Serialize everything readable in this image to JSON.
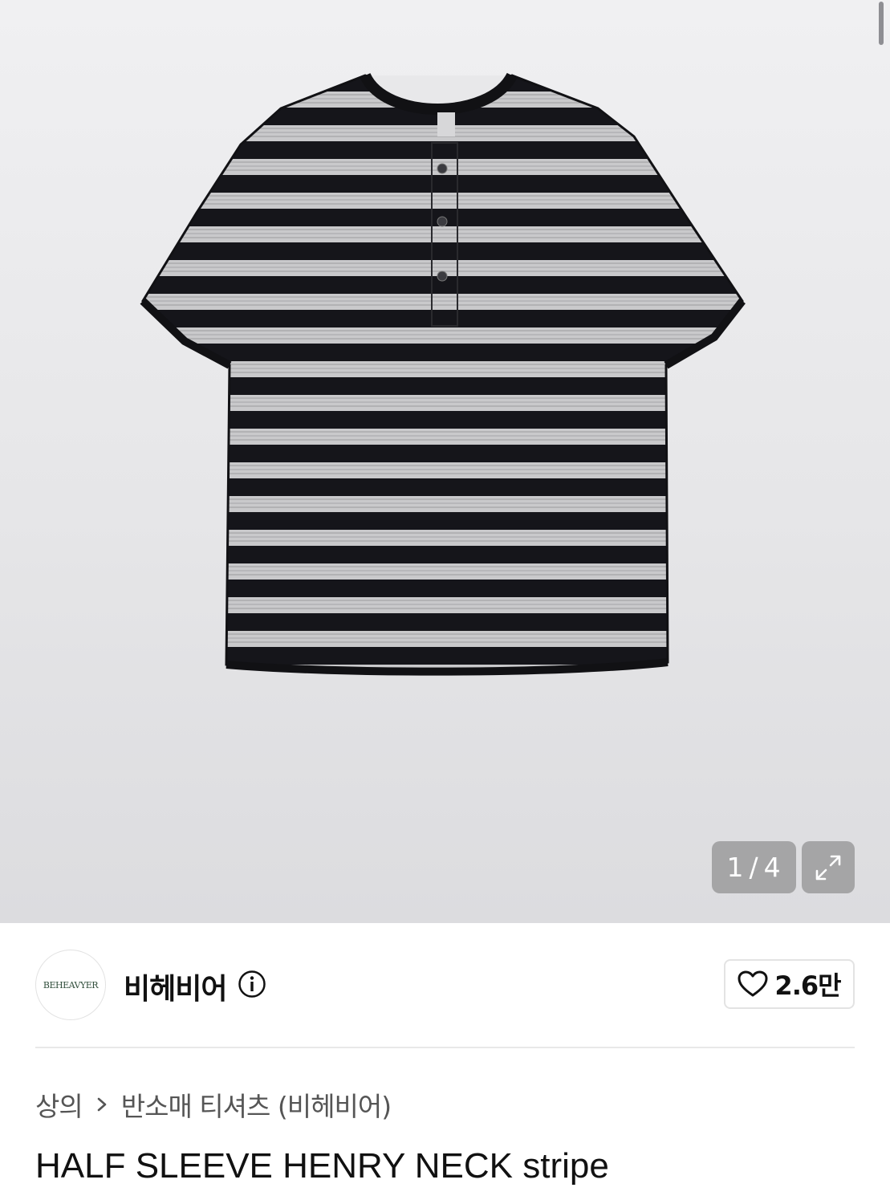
{
  "gallery": {
    "current_index": "1",
    "separator": "/",
    "total": "4",
    "image_alt": "HALF SLEEVE HENRY NECK stripe"
  },
  "brand": {
    "name": "비헤비어",
    "logo_text": "BEHEAVYER"
  },
  "likes": {
    "count": "2.6만"
  },
  "breadcrumb": {
    "category": "상의",
    "subcategory": "반소매 티셔츠 (비헤비어)"
  },
  "product": {
    "title": "HALF SLEEVE HENRY NECK stripe"
  },
  "colors": {
    "stripe_dark": "#15151a",
    "stripe_light": "#c9c9cb",
    "background": "#e8e8ea",
    "overlay": "#8a8a8a"
  }
}
